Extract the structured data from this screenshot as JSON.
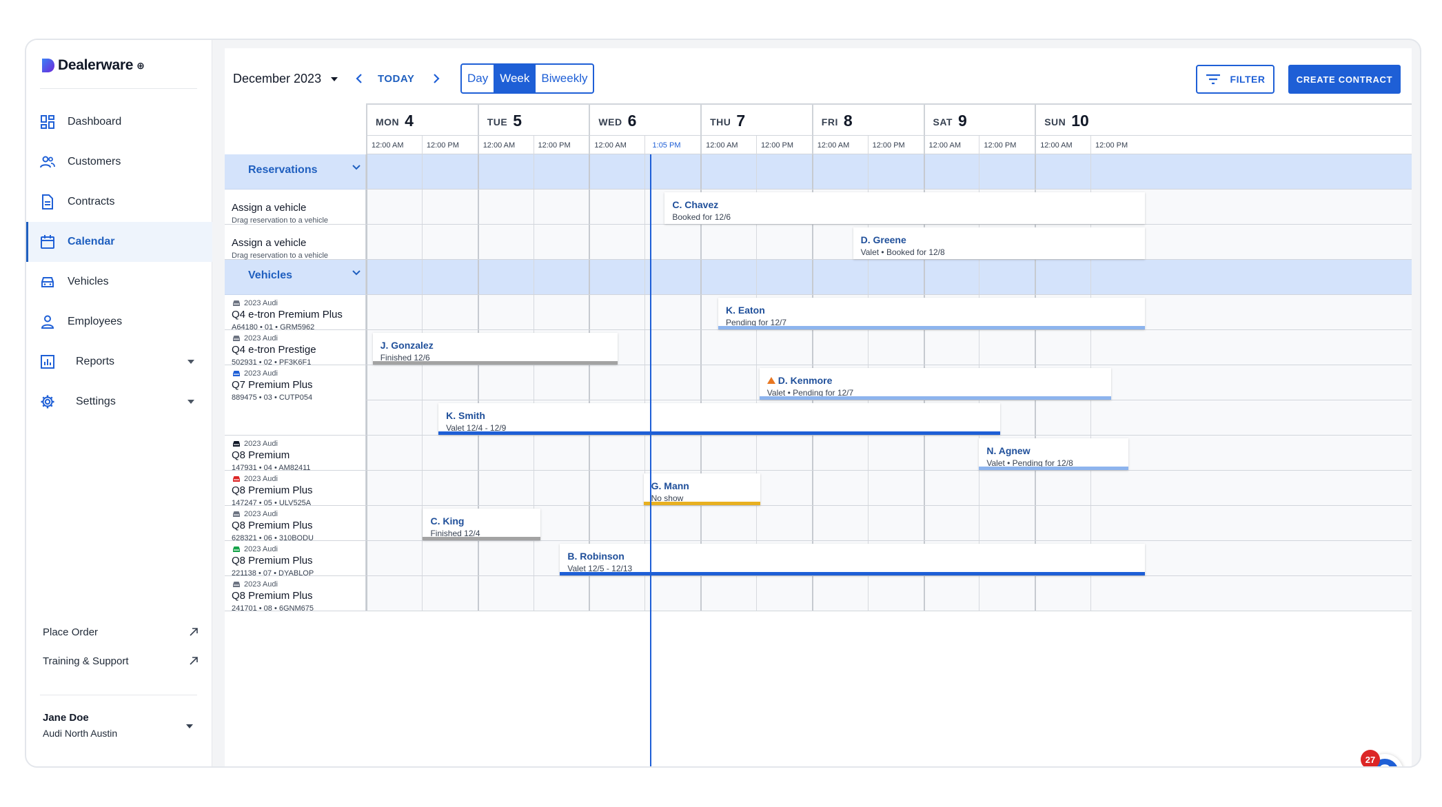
{
  "brand": {
    "name": "Dealerware",
    "suffix": "⊕"
  },
  "nav": [
    {
      "label": "Dashboard",
      "icon": "dashboard-icon",
      "active": false,
      "caret": false
    },
    {
      "label": "Customers",
      "icon": "customers-icon",
      "active": false,
      "caret": false
    },
    {
      "label": "Contracts",
      "icon": "contracts-icon",
      "active": false,
      "caret": false
    },
    {
      "label": "Calendar",
      "icon": "calendar-icon",
      "active": true,
      "caret": false
    },
    {
      "label": "Vehicles",
      "icon": "vehicles-icon",
      "active": false,
      "caret": false
    },
    {
      "label": "Employees",
      "icon": "employees-icon",
      "active": false,
      "caret": false
    },
    {
      "label": "Reports",
      "icon": "reports-icon",
      "active": false,
      "caret": true
    },
    {
      "label": "Settings",
      "icon": "settings-icon",
      "active": false,
      "caret": true
    }
  ],
  "side_links": [
    {
      "label": "Place Order",
      "icon": "external-link-icon"
    },
    {
      "label": "Training & Support",
      "icon": "external-link-icon"
    }
  ],
  "user": {
    "name": "Jane Doe",
    "location": "Audi North Austin"
  },
  "toolbar": {
    "month": "December 2023",
    "today": "TODAY",
    "views": [
      {
        "label": "Day",
        "on": false
      },
      {
        "label": "Week",
        "on": true
      },
      {
        "label": "Biweekly",
        "on": false
      }
    ],
    "filter": "FILTER",
    "create": "CREATE CONTRACT"
  },
  "days": [
    {
      "dow": "MON",
      "num": "4"
    },
    {
      "dow": "TUE",
      "num": "5"
    },
    {
      "dow": "WED",
      "num": "6"
    },
    {
      "dow": "THU",
      "num": "7"
    },
    {
      "dow": "FRI",
      "num": "8"
    },
    {
      "dow": "SAT",
      "num": "9"
    },
    {
      "dow": "SUN",
      "num": "10"
    }
  ],
  "time_labels": [
    "12:00 AM",
    "12:00 PM"
  ],
  "now": {
    "label": "1:05 PM",
    "day_offset": 2.545
  },
  "rows": [
    {
      "type": "group",
      "title": "Reservations"
    },
    {
      "type": "assign",
      "title": "Assign a vehicle",
      "sub": "Drag reservation to a vehicle"
    },
    {
      "type": "assign",
      "title": "Assign a vehicle",
      "sub": "Drag reservation to a vehicle"
    },
    {
      "type": "group",
      "title": "Vehicles"
    },
    {
      "type": "vehicle",
      "year": "2023 Audi",
      "model": "Q4 e-tron Premium Plus",
      "meta": "A64180 • 01 • GRM5962",
      "car_color": "#6b7280"
    },
    {
      "type": "vehicle",
      "year": "2023 Audi",
      "model": "Q4 e-tron Prestige",
      "meta": "502931 • 02 • PF3K6F1",
      "car_color": "#6b7280"
    },
    {
      "type": "vehicle",
      "year": "2023 Audi",
      "model": "Q7 Premium Plus",
      "meta": "889475 • 03 • CUTP054",
      "car_color": "#1e5fd6",
      "span": 2
    },
    {
      "type": "vehicle",
      "year": "2023 Audi",
      "model": "Q8 Premium",
      "meta": "147931 • 04 • AM82411",
      "car_color": "#111827"
    },
    {
      "type": "vehicle",
      "year": "2023 Audi",
      "model": "Q8 Premium Plus",
      "meta": "147247 • 05 • ULV525A",
      "car_color": "#dc2626"
    },
    {
      "type": "vehicle",
      "year": "2023 Audi",
      "model": "Q8 Premium Plus",
      "meta": "628321 • 06 • 310BODU",
      "car_color": "#6b7280"
    },
    {
      "type": "vehicle",
      "year": "2023 Audi",
      "model": "Q8 Premium Plus",
      "meta": "221138 • 07 • DYABLOP",
      "car_color": "#16a34a"
    },
    {
      "type": "vehicle",
      "year": "2023 Audi",
      "model": "Q8 Premium Plus",
      "meta": "241701 • 08 • 6GNM675",
      "car_color": "#6b7280"
    }
  ],
  "events": [
    {
      "name": "C. Chavez",
      "sub": "Booked for 12/6",
      "lane": 1,
      "start": 2.68,
      "end": 7.0,
      "bar": ""
    },
    {
      "name": "D. Greene",
      "sub": "Valet • Booked for 12/8",
      "lane": 2,
      "start": 4.37,
      "end": 7.0,
      "bar": ""
    },
    {
      "name": "K. Eaton",
      "sub": "Pending for 12/7",
      "lane": 4,
      "start": 3.16,
      "end": 7.0,
      "bar": "#8db4ee"
    },
    {
      "name": "J. Gonzalez",
      "sub": "Finished 12/6",
      "lane": 5,
      "start": 0.06,
      "end": 2.27,
      "bar": "#a3a3a3"
    },
    {
      "name": "D. Kenmore",
      "sub": "Valet • Pending for 12/7",
      "lane": 6,
      "start": 3.53,
      "end": 6.7,
      "bar": "#8db4ee",
      "warn": true
    },
    {
      "name": "K. Smith",
      "sub": "Valet 12/4 - 12/9",
      "lane": 7,
      "start": 0.65,
      "end": 5.7,
      "bar": "#1e5fd6"
    },
    {
      "name": "N. Agnew",
      "sub": "Valet • Pending for 12/8",
      "lane": 8,
      "start": 5.5,
      "end": 6.85,
      "bar": "#8db4ee"
    },
    {
      "name": "G. Mann",
      "sub": "No show",
      "lane": 9,
      "start": 2.49,
      "end": 3.55,
      "bar": "#e8b020"
    },
    {
      "name": "C. King",
      "sub": "Finished 12/4",
      "lane": 10,
      "start": 0.51,
      "end": 1.58,
      "bar": "#a3a3a3"
    },
    {
      "name": "B. Robinson",
      "sub": "Valet 12/5 - 12/13",
      "lane": 11,
      "start": 1.74,
      "end": 7.0,
      "bar": "#1e5fd6"
    }
  ],
  "help": {
    "label": "?",
    "badge": "27"
  }
}
